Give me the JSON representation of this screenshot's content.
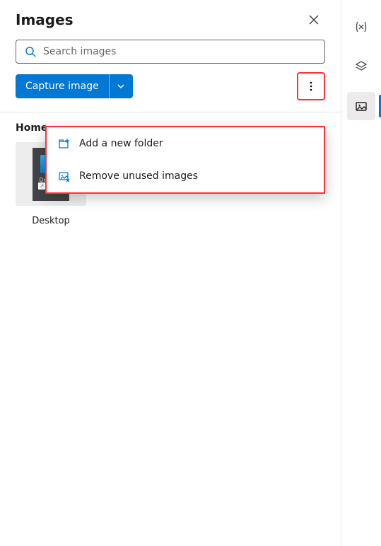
{
  "panel": {
    "title": "Images",
    "search_placeholder": "Search images",
    "capture_label": "Capture image"
  },
  "breadcrumb": "Home",
  "menu": {
    "add_folder": "Add a new folder",
    "remove_unused": "Remove unused images"
  },
  "thumbs": [
    {
      "label": "Desktop",
      "caption": "Desktop\nShortcut"
    }
  ],
  "rail": {
    "items": [
      {
        "name": "variables-icon"
      },
      {
        "name": "layers-icon"
      },
      {
        "name": "images-icon"
      }
    ],
    "active_index": 2
  },
  "colors": {
    "primary": "#0078d4",
    "highlight": "#f33"
  }
}
